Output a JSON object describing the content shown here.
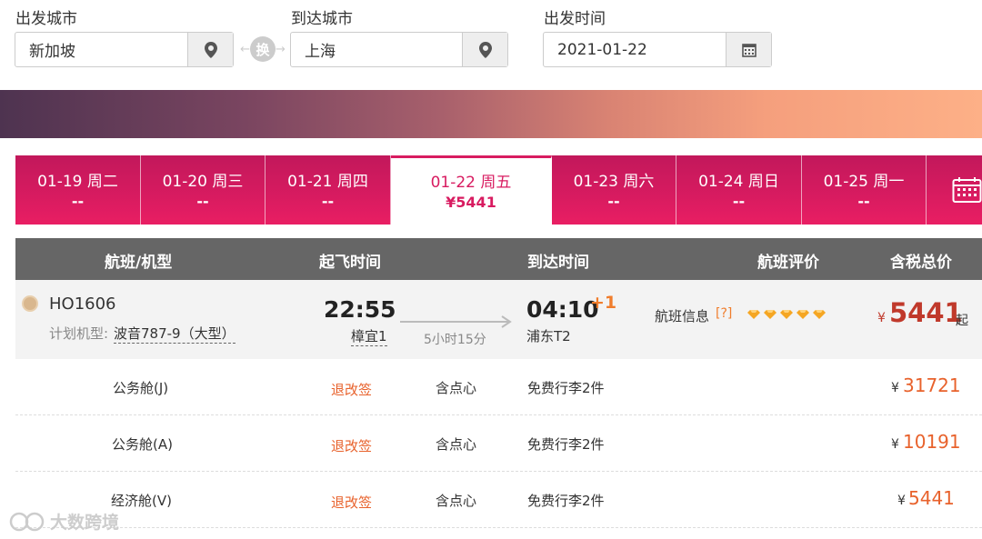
{
  "search": {
    "from_label": "出发城市",
    "from_value": "新加坡",
    "to_label": "到达城市",
    "to_value": "上海",
    "date_label": "出发时间",
    "date_value": "2021-01-22",
    "swap_label": "换"
  },
  "dates": [
    {
      "date": "01-19  周二",
      "price": "--"
    },
    {
      "date": "01-20  周三",
      "price": "--"
    },
    {
      "date": "01-21  周四",
      "price": "--"
    },
    {
      "date": "01-22  周五",
      "price": "¥5441",
      "active": true
    },
    {
      "date": "01-23  周六",
      "price": "--"
    },
    {
      "date": "01-24  周日",
      "price": "--"
    },
    {
      "date": "01-25  周一",
      "price": "--"
    }
  ],
  "table_header": {
    "flight": "航班/机型",
    "departure": "起飞时间",
    "arrival": "到达时间",
    "rating": "航班评价",
    "price": "含税总价"
  },
  "flight": {
    "number": "HO1606",
    "plane_label": "计划机型:",
    "plane": "波音787-9（大型）",
    "dep_time": "22:55",
    "dep_airport": "樟宜1",
    "duration": "5小时15分",
    "arr_time": "04:10",
    "day_offset": "+1",
    "arr_airport": "浦东T2",
    "info_label": "航班信息",
    "info_q": "[?]",
    "rating_stars": 5,
    "currency": "¥",
    "price": "5441",
    "price_suffix": "起"
  },
  "cabins": [
    {
      "name": "公务舱(J)",
      "refund": "退改签",
      "meal": "含点心",
      "baggage": "免费行李2件",
      "currency": "¥",
      "price": "31721"
    },
    {
      "name": "公务舱(A)",
      "refund": "退改签",
      "meal": "含点心",
      "baggage": "免费行李2件",
      "currency": "¥",
      "price": "10191"
    },
    {
      "name": "经济舱(V)",
      "refund": "退改签",
      "meal": "含点心",
      "baggage": "免费行李2件",
      "currency": "¥",
      "price": "5441"
    }
  ],
  "watermark": "大数跨境",
  "colors": {
    "accent": "#d81b60",
    "header_bg": "#666666",
    "price": "#c0392b",
    "orange": "#e8622c"
  }
}
